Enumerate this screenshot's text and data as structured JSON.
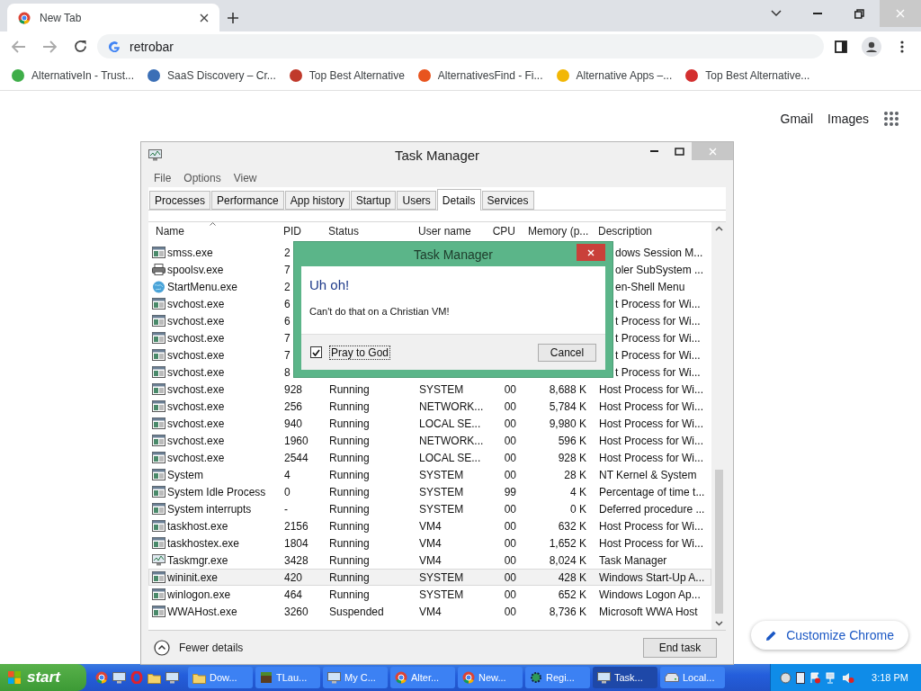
{
  "browser": {
    "tabs": [
      {
        "title": "New Tab",
        "selected": true
      }
    ],
    "address": "retrobar",
    "bookmarks": [
      {
        "label": "AlternativeIn - Trust...",
        "color": "#3fae49"
      },
      {
        "label": "SaaS Discovery – Cr...",
        "color": "#3b6fb6"
      },
      {
        "label": "Top Best Alternative",
        "color": "#c0392b"
      },
      {
        "label": "AlternativesFind - Fi...",
        "color": "#e8541e"
      },
      {
        "label": "Alternative Apps –...",
        "color": "#f2b705"
      },
      {
        "label": "Top Best Alternative...",
        "color": "#d32f2f"
      }
    ],
    "links": [
      "Gmail",
      "Images"
    ],
    "customize": "Customize Chrome"
  },
  "task_manager": {
    "title": "Task Manager",
    "menu": [
      "File",
      "Options",
      "View"
    ],
    "tabs": [
      {
        "label": "Processes",
        "selected": false
      },
      {
        "label": "Performance",
        "selected": false
      },
      {
        "label": "App history",
        "selected": false
      },
      {
        "label": "Startup",
        "selected": false
      },
      {
        "label": "Users",
        "selected": false
      },
      {
        "label": "Details",
        "selected": true
      },
      {
        "label": "Services",
        "selected": false
      }
    ],
    "columns": [
      "Name",
      "PID",
      "Status",
      "User name",
      "CPU",
      "Memory (p...",
      "Description"
    ],
    "rows": [
      {
        "kind": "app",
        "selected": false,
        "name": "smss.exe",
        "pid": "2",
        "description": "dows Session M..."
      },
      {
        "kind": "printer",
        "selected": false,
        "name": "spoolsv.exe",
        "pid": "7",
        "description": "oler SubSystem ..."
      },
      {
        "kind": "globe",
        "selected": false,
        "name": "StartMenu.exe",
        "pid": "2",
        "description": "en-Shell Menu"
      },
      {
        "kind": "app",
        "selected": false,
        "name": "svchost.exe",
        "pid": "6",
        "description": "t Process for Wi..."
      },
      {
        "kind": "app",
        "selected": false,
        "name": "svchost.exe",
        "pid": "6",
        "description": "t Process for Wi..."
      },
      {
        "kind": "app",
        "selected": false,
        "name": "svchost.exe",
        "pid": "7",
        "description": "t Process for Wi..."
      },
      {
        "kind": "app",
        "selected": false,
        "name": "svchost.exe",
        "pid": "7",
        "description": "t Process for Wi..."
      },
      {
        "kind": "app",
        "selected": false,
        "name": "svchost.exe",
        "pid": "8",
        "description": "t Process for Wi..."
      },
      {
        "kind": "app",
        "selected": false,
        "name": "svchost.exe",
        "pid": "928",
        "status": "Running",
        "user": "SYSTEM",
        "cpu": "00",
        "memory": "8,688 K",
        "description": "Host Process for Wi..."
      },
      {
        "kind": "app",
        "selected": false,
        "name": "svchost.exe",
        "pid": "256",
        "status": "Running",
        "user": "NETWORK...",
        "cpu": "00",
        "memory": "5,784 K",
        "description": "Host Process for Wi..."
      },
      {
        "kind": "app",
        "selected": false,
        "name": "svchost.exe",
        "pid": "940",
        "status": "Running",
        "user": "LOCAL SE...",
        "cpu": "00",
        "memory": "9,980 K",
        "description": "Host Process for Wi..."
      },
      {
        "kind": "app",
        "selected": false,
        "name": "svchost.exe",
        "pid": "1960",
        "status": "Running",
        "user": "NETWORK...",
        "cpu": "00",
        "memory": "596 K",
        "description": "Host Process for Wi..."
      },
      {
        "kind": "app",
        "selected": false,
        "name": "svchost.exe",
        "pid": "2544",
        "status": "Running",
        "user": "LOCAL SE...",
        "cpu": "00",
        "memory": "928 K",
        "description": "Host Process for Wi..."
      },
      {
        "kind": "app",
        "selected": false,
        "name": "System",
        "pid": "4",
        "status": "Running",
        "user": "SYSTEM",
        "cpu": "00",
        "memory": "28 K",
        "description": "NT Kernel & System"
      },
      {
        "kind": "app",
        "selected": false,
        "name": "System Idle Process",
        "pid": "0",
        "status": "Running",
        "user": "SYSTEM",
        "cpu": "99",
        "memory": "4 K",
        "description": "Percentage of time t..."
      },
      {
        "kind": "app",
        "selected": false,
        "name": "System interrupts",
        "pid": "-",
        "status": "Running",
        "user": "SYSTEM",
        "cpu": "00",
        "memory": "0 K",
        "description": "Deferred procedure ..."
      },
      {
        "kind": "app",
        "selected": false,
        "name": "taskhost.exe",
        "pid": "2156",
        "status": "Running",
        "user": "VM4",
        "cpu": "00",
        "memory": "632 K",
        "description": "Host Process for Wi..."
      },
      {
        "kind": "app",
        "selected": false,
        "name": "taskhostex.exe",
        "pid": "1804",
        "status": "Running",
        "user": "VM4",
        "cpu": "00",
        "memory": "1,652 K",
        "description": "Host Process for Wi..."
      },
      {
        "kind": "taskmgr",
        "selected": false,
        "name": "Taskmgr.exe",
        "pid": "3428",
        "status": "Running",
        "user": "VM4",
        "cpu": "00",
        "memory": "8,024 K",
        "description": "Task Manager"
      },
      {
        "kind": "app",
        "selected": true,
        "name": "wininit.exe",
        "pid": "420",
        "status": "Running",
        "user": "SYSTEM",
        "cpu": "00",
        "memory": "428 K",
        "description": "Windows Start-Up A..."
      },
      {
        "kind": "app",
        "selected": false,
        "name": "winlogon.exe",
        "pid": "464",
        "status": "Running",
        "user": "SYSTEM",
        "cpu": "00",
        "memory": "652 K",
        "description": "Windows Logon Ap..."
      },
      {
        "kind": "app",
        "selected": false,
        "name": "WWAHost.exe",
        "pid": "3260",
        "status": "Suspended",
        "user": "VM4",
        "cpu": "00",
        "memory": "8,736 K",
        "description": "Microsoft WWA Host"
      }
    ],
    "fewer_details": "Fewer details",
    "end_task": "End task"
  },
  "dialog": {
    "title": "Task Manager",
    "heading": "Uh oh!",
    "message": "Can't do that on a Christian VM!",
    "checkbox": {
      "label": "Pray to God",
      "checked": true
    },
    "cancel": "Cancel"
  },
  "taskbar": {
    "start": "start",
    "quick_launch": [
      {
        "kind": "chrome"
      },
      {
        "kind": "monitor"
      },
      {
        "kind": "opera"
      },
      {
        "kind": "folder"
      },
      {
        "kind": "monitor"
      }
    ],
    "buttons": [
      {
        "kind": "folder",
        "label": "Dow...",
        "selected": false
      },
      {
        "kind": "cube",
        "label": "TLau...",
        "selected": false
      },
      {
        "kind": "monitor",
        "label": "My C...",
        "selected": false
      },
      {
        "kind": "chrome",
        "label": "Alter...",
        "selected": false
      },
      {
        "kind": "chrome",
        "label": "New...",
        "selected": false
      },
      {
        "kind": "gear",
        "label": "Regi...",
        "selected": false
      },
      {
        "kind": "monitor",
        "label": "Task...",
        "selected": true
      },
      {
        "kind": "drive",
        "label": "Local...",
        "selected": false
      }
    ],
    "clock": "3:18 PM"
  }
}
